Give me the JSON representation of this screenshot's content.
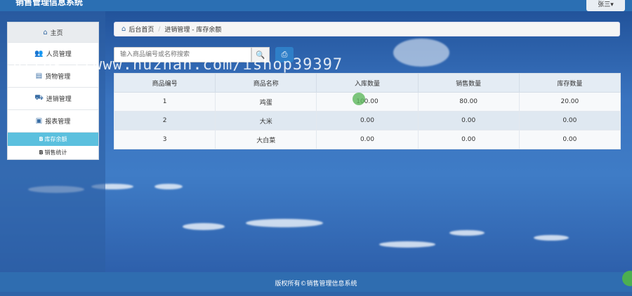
{
  "header": {
    "brand": "销售管理信息系统",
    "user": "张三▾"
  },
  "sidebar": {
    "home": "主页",
    "items": [
      {
        "label": "人员管理",
        "icon": "users-icon"
      },
      {
        "label": "货物管理",
        "icon": "book-icon"
      },
      {
        "label": "进销管理",
        "icon": "truck-icon"
      },
      {
        "label": "报表管理",
        "icon": "report-icon"
      }
    ],
    "subitems": [
      {
        "label": "库存余额",
        "active": true
      },
      {
        "label": "销售统计",
        "active": false
      }
    ]
  },
  "breadcrumb": {
    "home": "后台首页",
    "path": "进销管理 - 库存余额"
  },
  "search": {
    "placeholder": "输入商品编号或名称搜索"
  },
  "watermark": "https://www.huzhan.com/ishop39397",
  "table": {
    "headers": [
      "商品编号",
      "商品名称",
      "入库数量",
      "销售数量",
      "库存数量"
    ],
    "rows": [
      [
        "1",
        "鸡蛋",
        "100.00",
        "80.00",
        "20.00"
      ],
      [
        "2",
        "大米",
        "0.00",
        "0.00",
        "0.00"
      ],
      [
        "3",
        "大白菜",
        "0.00",
        "0.00",
        "0.00"
      ]
    ]
  },
  "footer": "版权所有©销售管理信息系统",
  "colors": {
    "accent": "#2f7fc8",
    "active_sub": "#5bc0de",
    "footer": "#2f6db0"
  }
}
